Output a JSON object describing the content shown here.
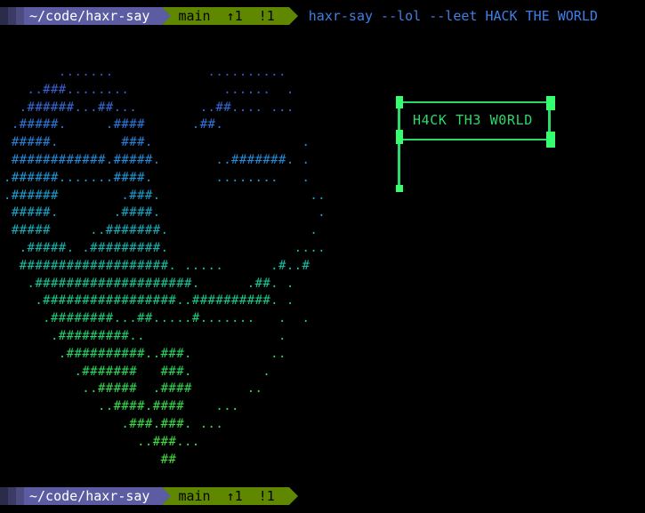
{
  "prompt_top": {
    "path": "~/code/haxr-say",
    "branch": "main",
    "ahead": "↑1",
    "modified": "!1",
    "command": "haxr-say --lol --leet HACK THE WORLD"
  },
  "prompt_bottom": {
    "path": "~/code/haxr-say",
    "branch": "main",
    "ahead": "↑1",
    "modified": "!1"
  },
  "flag": {
    "text": "H4CK TH3 W0RLD"
  },
  "art": {
    "lines": [
      "       .......            ..........",
      "   ..###........            ......  .",
      "  .######...##...        ..##.... ...",
      " .#####.     .####      .##.",
      " #####.        ###.                   .",
      " ############.#####.       ..#######. .",
      ".######.......####.        ........   .",
      ".######        .###.                   ..",
      " #####.       .####.                    .",
      " #####     ..#######.                  .",
      "  .#####. .#########.                ....",
      "  ###################. .....      .#..#",
      "   .####################.      .##. .",
      "    .#################..##########. .",
      "     .########...##.....#.......   .  .",
      "      .#########..                 .",
      "       .##########..###.          ..",
      "         .#######   ###.         .",
      "          ..#####  .####       ..",
      "            ..####.####    ...",
      "               .###.###. ...",
      "                 ..###...",
      "                    ##"
    ],
    "colors": [
      "#3b52c9",
      "#3a5fd0",
      "#3569d6",
      "#2f76d8",
      "#2b80d8",
      "#2589d6",
      "#2094d2",
      "#1b9ccb",
      "#18a5c4",
      "#16adba",
      "#16b5ae",
      "#16bda2",
      "#17c495",
      "#1ac988",
      "#1ece7a",
      "#22d26e",
      "#27d564",
      "#2bd85a",
      "#2fda52",
      "#34dc4b",
      "#38dd45",
      "#3cde40",
      "#40df3b"
    ]
  },
  "colors": {
    "path_segment": "#5c5ca3",
    "git_segment": "#5f8700",
    "command_text": "#3f7fe6",
    "flag": "#2bd96b"
  }
}
